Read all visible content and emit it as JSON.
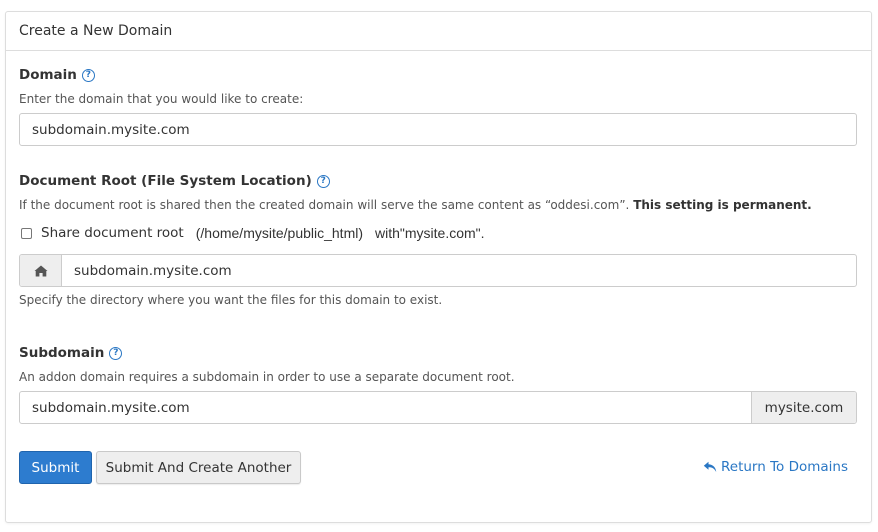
{
  "panel": {
    "title": "Create a New Domain"
  },
  "domain": {
    "label": "Domain",
    "help": "?",
    "description": "Enter the domain that you would like to create:",
    "value": "subdomain.mysite.com"
  },
  "document_root": {
    "label": "Document Root (File System Location)",
    "help": "?",
    "description_prefix": "If the document root is shared then the created domain will serve the same content as “oddesi.com”.",
    "description_bold": "This setting is permanent.",
    "share_label": "Share document root",
    "share_path": "(/home/mysite/public_html)",
    "share_with": "with\"mysite.com\".",
    "share_checked": false,
    "icon": "home-icon",
    "value": "subdomain.mysite.com",
    "hint": "Specify the directory where you want the files for this domain to exist."
  },
  "subdomain": {
    "label": "Subdomain",
    "help": "?",
    "description": "An addon domain requires a subdomain in order to use a separate document root.",
    "value": "subdomain.mysite.com",
    "suffix": "mysite.com"
  },
  "actions": {
    "submit_label": "Submit",
    "submit_another_label": "Submit And Create Another",
    "return_label": "Return To Domains",
    "return_icon": "reply-arrow-icon"
  },
  "colors": {
    "primary": "#2d7ccf",
    "link": "#2a77c4",
    "border": "#cccccc"
  }
}
